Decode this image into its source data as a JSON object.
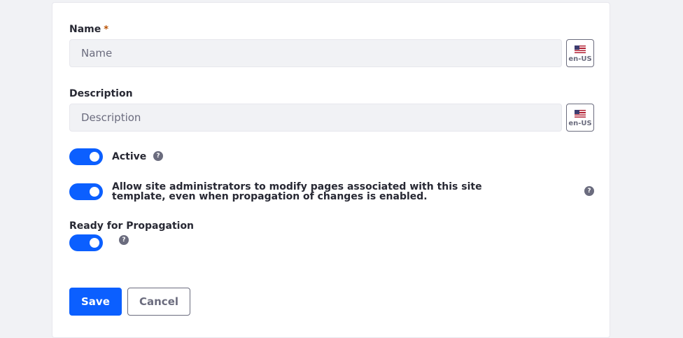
{
  "form": {
    "name": {
      "label": "Name",
      "required_mark": "*",
      "placeholder": "Name",
      "value": "",
      "locale": "en-US"
    },
    "description": {
      "label": "Description",
      "placeholder": "Description",
      "value": "",
      "locale": "en-US"
    },
    "active": {
      "label": "Active",
      "checked": true,
      "help": "?"
    },
    "allow_modify": {
      "label": "Allow site administrators to modify pages associated with this site template, even when propagation of changes is enabled.",
      "checked": true,
      "help": "?"
    },
    "ready_for_propagation": {
      "label": "Ready for Propagation",
      "checked": true,
      "help": "?"
    },
    "actions": {
      "save_label": "Save",
      "cancel_label": "Cancel"
    }
  },
  "colors": {
    "primary": "#0b5fff",
    "required": "#b95000",
    "input_bg": "#f1f2f5",
    "muted": "#6b6c7e"
  },
  "icons": {
    "locale_flag": "us-flag-icon",
    "help": "question-circle-icon"
  }
}
